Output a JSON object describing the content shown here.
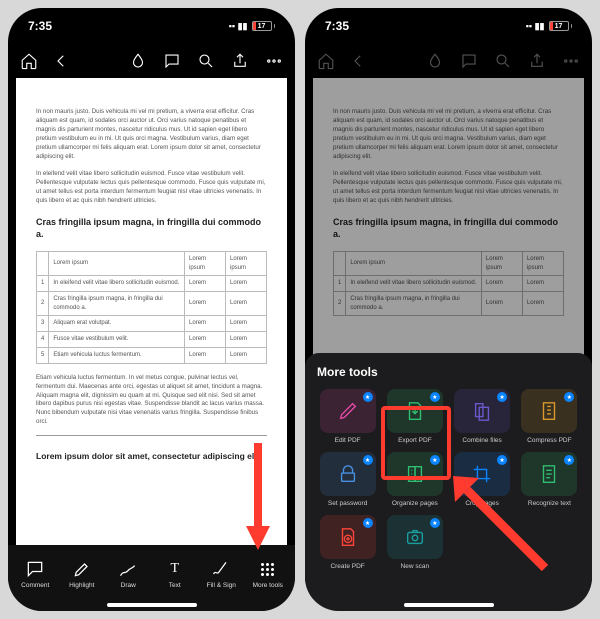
{
  "status": {
    "time": "7:35",
    "battery": "17"
  },
  "doc": {
    "p1": "In non mauris justo. Duis vehicula mi vel mi pretium, a viverra erat efficitur. Cras aliquam est quam, id sodales orci auctor ut. Orci varius natoque penatibus et magnis dis parturient montes, nascetur ridiculus mus. Ut id sapien eget libero pretium vestibulum eu in mi. Ut quis orci magna. Vestibulum varius, diam eget pretium ullamcorper mi felis aliquam erat. Lorem ipsum dolor sit amet, consectetur adipiscing elit.",
    "p2": "In eleifend velit vitae libero sollicitudin euismod. Fusce vitae vestibulum velit. Pellentesque vulputate lectus quis pellentesque commodo. Fusce quis vulputate mi, ut amet tellus est porta interdum fermentum feugiat nisl vitae ultricies venenatis. In quis libero et ac quis nibh hendrerit ultricies.",
    "heading": "Cras fringilla ipsum magna, in fringilla dui commodo a.",
    "th0": "",
    "th1": "Lorem ipsum",
    "th2": "Lorem ipsum",
    "th3": "Lorem ipsum",
    "rows": [
      {
        "n": "1",
        "c1": "In eleifend velit vitae libero sollicitudin euismod.",
        "c2": "Lorem",
        "c3": "Lorem"
      },
      {
        "n": "2",
        "c1": "Cras fringilla ipsum magna, in fringilla dui commodo a.",
        "c2": "Lorem",
        "c3": "Lorem"
      },
      {
        "n": "3",
        "c1": "Aliquam erat volutpat.",
        "c2": "Lorem",
        "c3": "Lorem"
      },
      {
        "n": "4",
        "c1": "Fusce vitae vestibulum velit.",
        "c2": "Lorem",
        "c3": "Lorem"
      },
      {
        "n": "5",
        "c1": "Etiam vehicula luctus fermentum.",
        "c2": "Lorem",
        "c3": "Lorem"
      }
    ],
    "p3": "Etiam vehicula luctus fermentum. In vel metus congue, pulvinar lectus vel, fermentum dui. Maecenas ante orci, egestas ut aliquet sit amet, tincidunt a magna. Aliquam magna elit, dignissim eu quam at mi. Quisque sed elit nisi. Sed sit amet libero dapibus purus nisi egestas vitae. Suspendisse blandit ac lacus varius massa. Nunc bibendum vulputate nisi vitae venenatis varius fringilla. Suspendisse finibus orci.",
    "footer_h": "Lorem ipsum dolor sit amet, consectetur adipiscing elit."
  },
  "bottombar": {
    "comment": "Comment",
    "highlight": "Highlight",
    "draw": "Draw",
    "text": "Text",
    "fill_sign": "Fill & Sign",
    "more_tools": "More tools"
  },
  "sheet": {
    "title": "More tools",
    "tools": [
      {
        "label": "Edit PDF",
        "color": "#e64aa9"
      },
      {
        "label": "Export PDF",
        "color": "#2fbf71"
      },
      {
        "label": "Combine files",
        "color": "#6a5acd"
      },
      {
        "label": "Compress PDF",
        "color": "#d99a2b"
      },
      {
        "label": "Set password",
        "color": "#4a90e2"
      },
      {
        "label": "Organize pages",
        "color": "#2fbf71"
      },
      {
        "label": "Crop pages",
        "color": "#0a84ff"
      },
      {
        "label": "Recognize text",
        "color": "#2fbf71"
      },
      {
        "label": "Create PDF",
        "color": "#ff453a"
      },
      {
        "label": "New scan",
        "color": "#1aa0a0"
      }
    ]
  }
}
